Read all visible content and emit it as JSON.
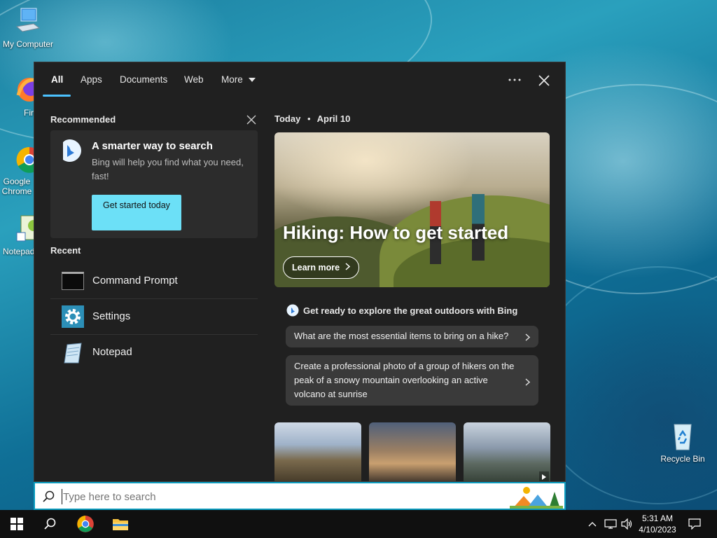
{
  "desktop": {
    "icons": [
      {
        "label": "My Computer",
        "icon": "computer-icon"
      },
      {
        "label": "Firefox",
        "icon": "firefox-icon"
      },
      {
        "label": "Google Chrome",
        "icon": "chrome-icon"
      },
      {
        "label": "Notepad",
        "icon": "notepad-icon"
      },
      {
        "label": "Recycle Bin",
        "icon": "recycle-bin-icon"
      }
    ]
  },
  "search_panel": {
    "tabs": [
      {
        "label": "All",
        "active": true
      },
      {
        "label": "Apps"
      },
      {
        "label": "Documents"
      },
      {
        "label": "Web"
      },
      {
        "label": "More"
      }
    ],
    "more_icon": "ellipsis-icon",
    "close_icon": "close-icon",
    "recommended": {
      "title": "Recommended",
      "card": {
        "heading": "A smarter way to search",
        "body": "Bing will help you find what you need, fast!",
        "button": "Get started today"
      }
    },
    "recent": {
      "title": "Recent",
      "items": [
        {
          "label": "Command Prompt",
          "icon": "command-prompt-icon"
        },
        {
          "label": "Settings",
          "icon": "settings-gear-icon"
        },
        {
          "label": "Notepad",
          "icon": "notepad-icon"
        }
      ]
    },
    "today": {
      "label": "Today",
      "separator": "•",
      "date": "April 10",
      "hero_title": "Hiking: How to get started",
      "learn_more": "Learn more",
      "bing_prompt": "Get ready to explore the great outdoors with Bing",
      "suggestions": [
        "What are the most essential items to bring on a hike?",
        "Create a professional photo of a group of hikers on the peak of a snowy mountain overlooking an active volcano at sunrise"
      ]
    }
  },
  "search_box": {
    "placeholder": "Type here to search"
  },
  "taskbar": {
    "clock_time": "5:31 AM",
    "clock_date": "4/10/2023",
    "accent": "#0c9fc2"
  }
}
